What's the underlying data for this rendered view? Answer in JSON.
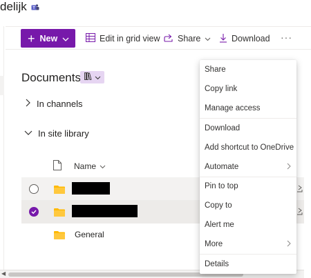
{
  "site": {
    "title": "delijk"
  },
  "commandbar": {
    "new_label": "New",
    "edit_grid_label": "Edit in grid view",
    "share_label": "Share",
    "download_label": "Download",
    "more_label": "···"
  },
  "library": {
    "title": "Documents",
    "groups": [
      {
        "label": "In channels",
        "expanded": false
      },
      {
        "label": "In site library",
        "expanded": true
      }
    ],
    "column_name": "Name",
    "rows": [
      {
        "label": "",
        "redacted": true,
        "selected": false
      },
      {
        "label": "",
        "redacted": true,
        "selected": true
      },
      {
        "label": "General",
        "redacted": false,
        "selected": false
      }
    ]
  },
  "context_menu": {
    "items": [
      {
        "label": "Share",
        "submenu": false
      },
      {
        "label": "Copy link",
        "submenu": false
      },
      {
        "label": "Manage access",
        "submenu": false
      },
      {
        "label": "Download",
        "submenu": false
      },
      {
        "label": "Add shortcut to OneDrive",
        "submenu": false
      },
      {
        "label": "Automate",
        "submenu": true
      },
      {
        "label": "Pin to top",
        "submenu": false
      },
      {
        "label": "Copy to",
        "submenu": false
      },
      {
        "label": "Alert me",
        "submenu": false
      },
      {
        "label": "More",
        "submenu": true
      },
      {
        "label": "Details",
        "submenu": false
      }
    ]
  },
  "colors": {
    "accent": "#7719aa",
    "folder": "#ffb900",
    "view_button_bg": "#e6d5f2"
  }
}
